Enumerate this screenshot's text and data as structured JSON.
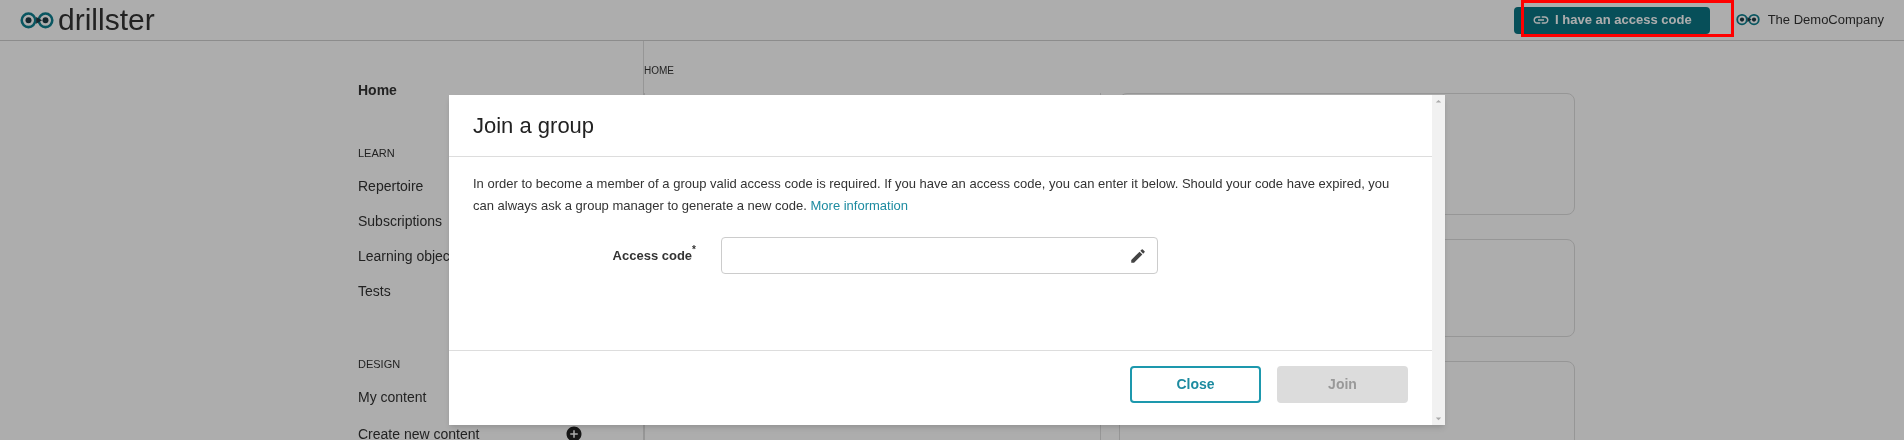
{
  "header": {
    "logo": "drillster",
    "access_button": {
      "label": "I have an access code",
      "highlighted": true
    },
    "company": "The DemoCompany"
  },
  "sidebar": {
    "home": "Home",
    "sections": [
      {
        "title": "LEARN",
        "items": [
          {
            "label": "Repertoire",
            "kind": "link"
          },
          {
            "label": "Subscriptions",
            "kind": "link"
          },
          {
            "label": "Learning objec",
            "kind": "link"
          },
          {
            "label": "Tests",
            "kind": "link"
          }
        ]
      },
      {
        "title": "DESIGN",
        "items": [
          {
            "label": "My content",
            "kind": "link"
          },
          {
            "label": "Create new content",
            "kind": "create"
          }
        ]
      }
    ]
  },
  "breadcrumb": "HOME",
  "modal": {
    "title": "Join a group",
    "text": "In order to become a member of a group valid access code is required. If you have an access code, you can enter it below. Should your code have expired, you can always ask a group manager to generate a new code.",
    "link": "More information",
    "field": {
      "label": "Access code",
      "required_mark": "*"
    },
    "buttons": [
      {
        "label": "Close",
        "kind": "secondary",
        "disabled": false
      },
      {
        "label": "Join",
        "kind": "primary",
        "disabled": true
      }
    ]
  }
}
